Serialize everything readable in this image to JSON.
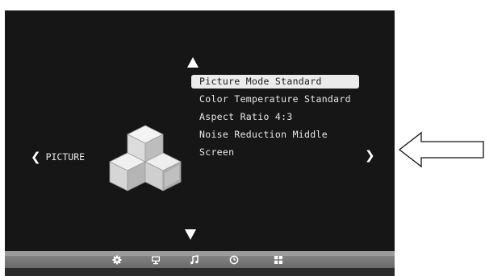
{
  "menu": {
    "items": [
      {
        "label": "Picture Mode Standard",
        "selected": true
      },
      {
        "label": "Color Temperature Standard",
        "selected": false
      },
      {
        "label": "Aspect Ratio 4:3",
        "selected": false
      },
      {
        "label": "Noise Reduction Middle",
        "selected": false
      },
      {
        "label": "Screen",
        "selected": false
      }
    ]
  },
  "nav": {
    "left_label": "PICTURE",
    "left_icon": "chevron-left-icon",
    "right_icon": "chevron-right-icon",
    "up_icon": "triangle-up-icon",
    "down_icon": "triangle-down-icon"
  },
  "bottom_bar": {
    "icons": [
      "gear-icon",
      "monitor-icon",
      "music-note-icon",
      "clock-icon",
      "grid-icon"
    ],
    "active": "monitor-icon"
  },
  "colors": {
    "screen_bg": "#161616",
    "highlight": "#ebebeb",
    "bar": "#7a7a7a"
  }
}
